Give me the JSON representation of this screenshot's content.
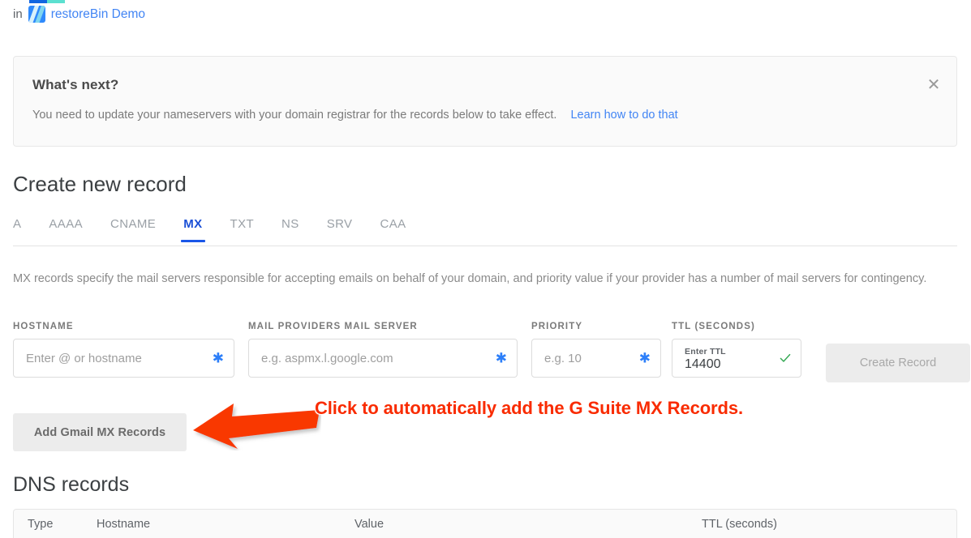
{
  "breadcrumb": {
    "prefix": "in",
    "logo_icon": "restorebin-logo-icon",
    "site_name": "restoreBin Demo",
    "link_color": "#4285f4"
  },
  "banner": {
    "title": "What's next?",
    "body": "You need to update your nameservers with your domain registrar for the records below to take effect.",
    "link_label": "Learn how to do that",
    "close_icon": "✕"
  },
  "create_record": {
    "heading": "Create new record",
    "tabs": [
      {
        "label": "A",
        "active": false
      },
      {
        "label": "AAAA",
        "active": false
      },
      {
        "label": "CNAME",
        "active": false
      },
      {
        "label": "MX",
        "active": true
      },
      {
        "label": "TXT",
        "active": false
      },
      {
        "label": "NS",
        "active": false
      },
      {
        "label": "SRV",
        "active": false
      },
      {
        "label": "CAA",
        "active": false
      }
    ],
    "active_tab": "MX",
    "active_tab_color": "#1a56e8",
    "description": "MX records specify the mail servers responsible for accepting emails on behalf of your domain, and priority value if your provider has a number of mail servers for contingency.",
    "fields": {
      "hostname": {
        "label": "HOSTNAME",
        "placeholder": "Enter @ or hostname",
        "value": "",
        "required_marker": "✱"
      },
      "mail_server": {
        "label": "MAIL PROVIDERS MAIL SERVER",
        "placeholder": "e.g. aspmx.l.google.com",
        "value": "",
        "required_marker": "✱"
      },
      "priority": {
        "label": "PRIORITY",
        "placeholder": "e.g. 10",
        "value": "",
        "required_marker": "✱"
      },
      "ttl": {
        "label": "TTL (SECONDS)",
        "float_label": "Enter TTL",
        "value": "14400",
        "valid_icon": "checkmark-icon",
        "valid_color": "#34a853"
      }
    },
    "create_button": {
      "label": "Create Record",
      "disabled": true
    },
    "gmail_button": {
      "label": "Add Gmail MX Records"
    }
  },
  "annotation": {
    "text": "Click to automatically add the G Suite MX Records.",
    "color": "#f92b00",
    "arrow_icon": "left-arrow-annotation",
    "arrow_color": "#f93800"
  },
  "dns_records": {
    "heading": "DNS records",
    "columns": [
      "Type",
      "Hostname",
      "Value",
      "TTL (seconds)"
    ],
    "rows": []
  }
}
